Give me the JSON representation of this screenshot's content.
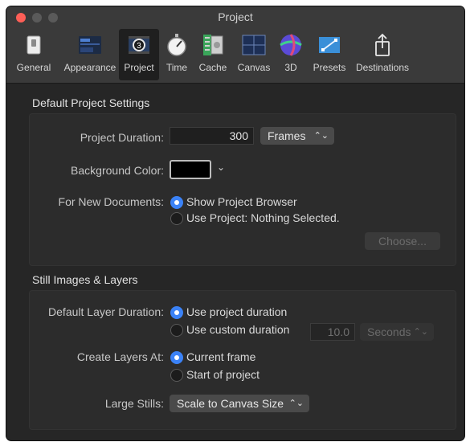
{
  "window": {
    "title": "Project"
  },
  "toolbar": {
    "items": [
      {
        "label": "General",
        "icon": "switch-icon"
      },
      {
        "label": "Appearance",
        "icon": "appearance-icon"
      },
      {
        "label": "Project",
        "icon": "project-icon"
      },
      {
        "label": "Time",
        "icon": "stopwatch-icon"
      },
      {
        "label": "Cache",
        "icon": "cache-icon"
      },
      {
        "label": "Canvas",
        "icon": "canvas-icon"
      },
      {
        "label": "3D",
        "icon": "sphere-icon"
      },
      {
        "label": "Presets",
        "icon": "presets-icon"
      },
      {
        "label": "Destinations",
        "icon": "share-icon"
      }
    ],
    "selected": "Project"
  },
  "default_project": {
    "title": "Default Project Settings",
    "duration_label": "Project Duration:",
    "duration_value": "300",
    "duration_unit": "Frames",
    "background_label": "Background Color:",
    "background_color": "#000000",
    "new_docs_label": "For New Documents:",
    "option_browser": "Show Project Browser",
    "option_use_project": "Use Project: Nothing Selected.",
    "choose_button": "Choose..."
  },
  "still_images": {
    "title": "Still Images & Layers",
    "layer_duration_label": "Default Layer Duration:",
    "option_project_duration": "Use project duration",
    "option_custom_duration": "Use custom duration",
    "custom_value": "10.0",
    "custom_unit": "Seconds",
    "create_at_label": "Create Layers At:",
    "option_current_frame": "Current frame",
    "option_start_project": "Start of project",
    "large_stills_label": "Large Stills:",
    "large_stills_value": "Scale to Canvas Size"
  },
  "colors": {
    "accent": "#3b82f6",
    "close": "#fe5f57"
  }
}
